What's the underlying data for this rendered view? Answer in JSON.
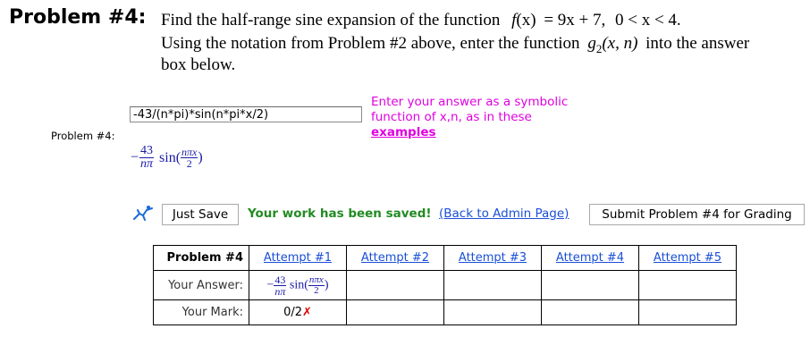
{
  "problem": {
    "title": "Problem #4:",
    "line1_text": "Find the half-range sine expansion of the function",
    "line1_func": "f",
    "line1_x": "(x)",
    "line1_eq": "= 9x + 7,",
    "line1_domain": "0 < x < 4.",
    "line2": "Using the notation from Problem #2 above, enter the function",
    "line2_func": "g",
    "line2_sub": "2",
    "line2_args": "(x, n)",
    "line2_end": "into the answer",
    "line3": "box below."
  },
  "answer": {
    "label": "Problem #4:",
    "value": "-43/(n*pi)*sin(n*pi*x/2)",
    "hint_line1": "Enter your answer as a symbolic",
    "hint_line2": "function of x,n, as in these",
    "hint_link": "examples"
  },
  "preview": {
    "minus": "−",
    "num": "43",
    "den": "nπ",
    "sin": "sin(",
    "arg_num": "nπx",
    "arg_den": "2",
    "close": ")"
  },
  "actions": {
    "just_save": "Just Save",
    "saved_message": "Your work has been saved!",
    "admin_link": "(Back to Admin Page)",
    "submit": "Submit Problem #4 for Grading"
  },
  "attempts_table": {
    "header_label": "Problem #4",
    "attempts": [
      "Attempt #1",
      "Attempt #2",
      "Attempt #3",
      "Attempt #4",
      "Attempt #5"
    ],
    "row_answer_label": "Your Answer:",
    "row_mark_label": "Your Mark:",
    "mark1": "0/2",
    "mark1_symbol": "✗"
  },
  "colors": {
    "hint": "#e000e0",
    "saved": "#228b22",
    "link": "#1a4fd6",
    "math": "#1a1aa8",
    "wrong": "#e00000"
  },
  "icons": {
    "save_icon": "stick-figure-icon"
  }
}
